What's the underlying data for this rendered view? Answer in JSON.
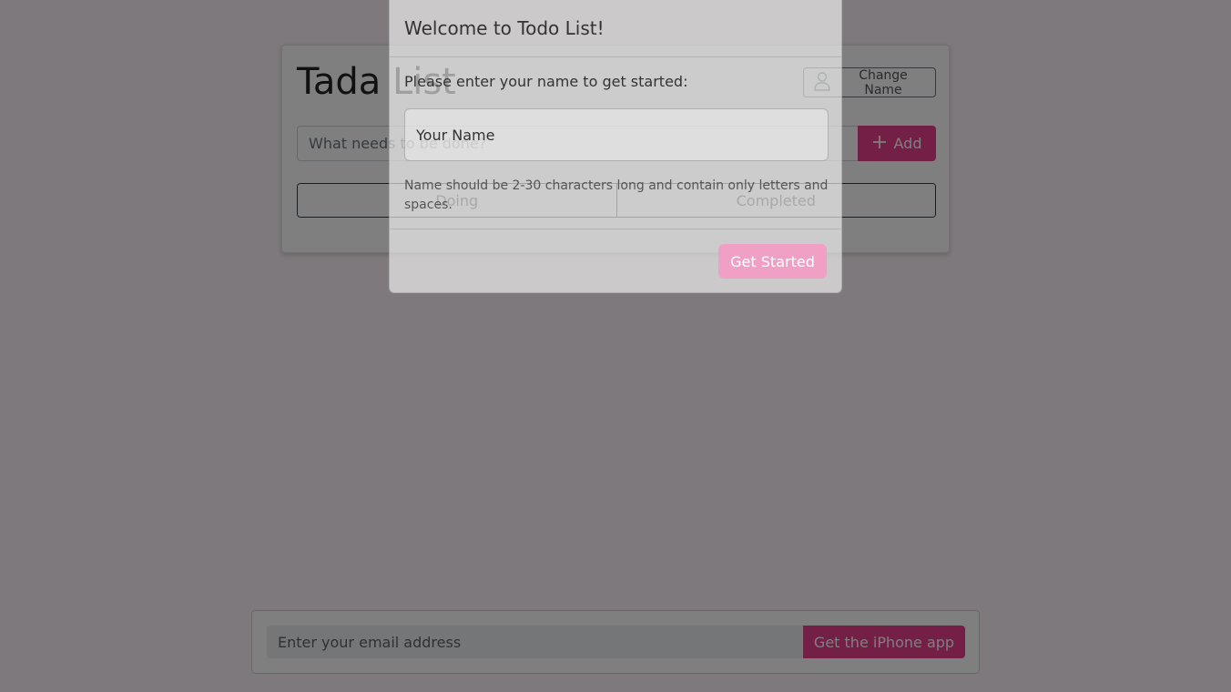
{
  "app": {
    "title": "Tada List",
    "change_name_label": "Change Name",
    "new_todo_placeholder": "What needs to be done?",
    "add_label": "Add",
    "filters": [
      "Doing",
      "Completed"
    ]
  },
  "footer": {
    "email_placeholder": "Enter your email address",
    "cta_label": "Get the iPhone app"
  },
  "modal": {
    "title": "Welcome to Todo List!",
    "prompt": "Please enter your name to get started:",
    "name_placeholder": "Your Name",
    "help_text": "Name should be 2-30 characters long and contain only letters and spaces.",
    "submit_label": "Get Started"
  },
  "colors": {
    "accent": "#e83e8c",
    "accent_disabled": "#f0a0c4",
    "backdrop": "rgba(0,0,0,0.5)"
  },
  "icons": {
    "change_name": "person-icon",
    "add": "plus-icon"
  }
}
